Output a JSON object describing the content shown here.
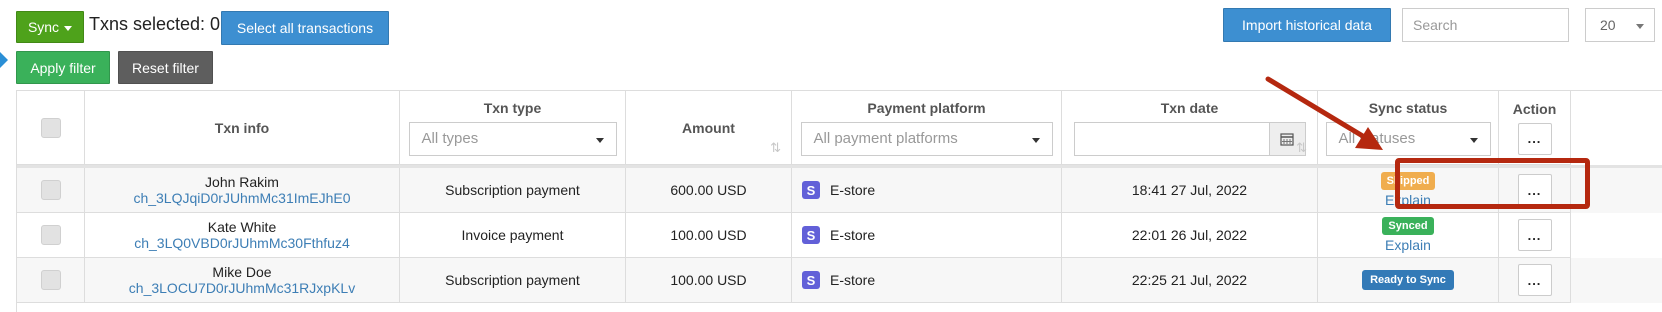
{
  "toolbar": {
    "sync_label": "Sync",
    "txns_selected_label": "Txns selected: 0",
    "select_all_label": "Select all transactions",
    "import_label": "Import historical data",
    "search_placeholder": "Search",
    "page_size": "20",
    "apply_filter_label": "Apply filter",
    "reset_filter_label": "Reset filter"
  },
  "table": {
    "headers": {
      "txn_info": "Txn info",
      "txn_type": "Txn type",
      "amount": "Amount",
      "payment_platform": "Payment platform",
      "txn_date": "Txn date",
      "sync_status": "Sync status",
      "action": "Action"
    },
    "filters": {
      "txn_type": "All types",
      "payment_platform": "All payment platforms",
      "sync_status": "All statuses"
    },
    "action_glyph": "...",
    "rows": [
      {
        "name": "John Rakim",
        "txn_id": "ch_3LQJqiD0rJUhmMc31ImEJhE0",
        "type": "Subscription payment",
        "amount": "600.00 USD",
        "platform": "E-store",
        "platform_icon": "S",
        "date": "18:41 27 Jul, 2022",
        "status": "Skipped",
        "status_color": "#f0ad4e",
        "status_link": "Explain"
      },
      {
        "name": "Kate White",
        "txn_id": "ch_3LQ0VBD0rJUhmMc30Fthfuz4",
        "type": "Invoice payment",
        "amount": "100.00 USD",
        "platform": "E-store",
        "platform_icon": "S",
        "date": "22:01 26 Jul, 2022",
        "status": "Synced",
        "status_color": "#3ab15a",
        "status_link": "Explain"
      },
      {
        "name": "Mike Doe",
        "txn_id": "ch_3LOCU7D0rJUhmMc31RJxpKLv",
        "type": "Subscription payment",
        "amount": "100.00 USD",
        "platform": "E-store",
        "platform_icon": "S",
        "date": "22:25 21 Jul, 2022",
        "status": "Ready to Sync",
        "status_color": "#337ab7",
        "status_link": ""
      }
    ]
  },
  "annotation_color": "#b5280f"
}
